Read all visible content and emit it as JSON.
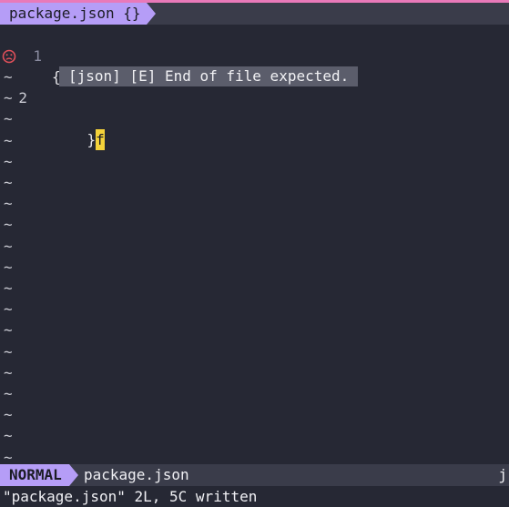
{
  "tabline": {
    "tab_label": "package.json {}"
  },
  "editor": {
    "lines": [
      {
        "number": "1",
        "text": "{",
        "sign": ""
      },
      {
        "number": "2",
        "text": "}",
        "cursor_char": "f",
        "sign": "error-face-icon"
      }
    ],
    "empty_marker": "~",
    "diagnostic_popup": "[json] [E] End of file expected."
  },
  "statusline": {
    "mode": "NORMAL",
    "filename": "package.json",
    "right_text": "j"
  },
  "cmdline": {
    "message": "\"package.json\" 2L, 5C written"
  },
  "colors": {
    "background": "#262834",
    "accent": "#b59df7",
    "cursor": "#f4d23a",
    "error": "#e0505a",
    "top_border": "#e879b9"
  }
}
